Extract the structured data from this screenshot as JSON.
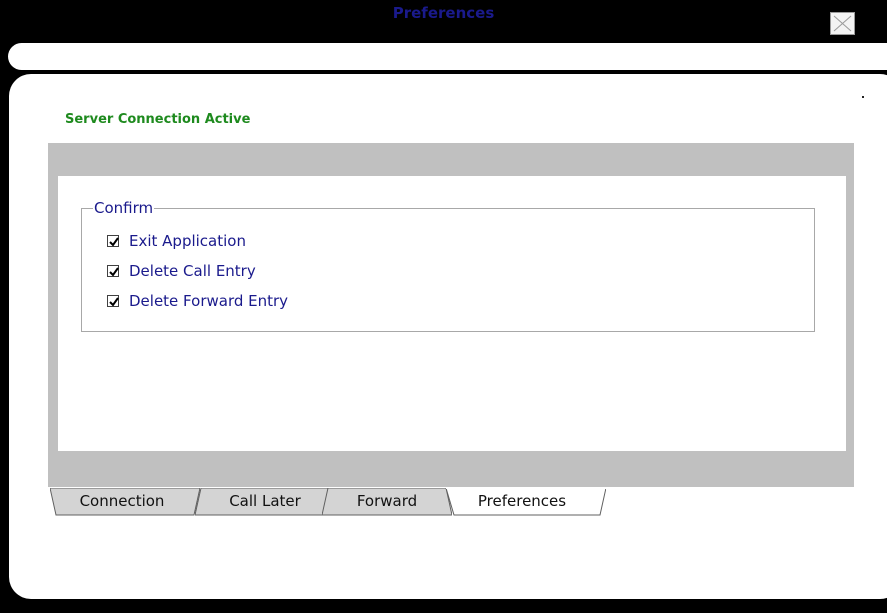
{
  "window": {
    "title": "Preferences",
    "close_icon": "close-icon"
  },
  "status": {
    "text": "Server Connection Active",
    "color": "#1e8a1e"
  },
  "confirm": {
    "legend": "Confirm",
    "items": [
      {
        "label": "Exit Application",
        "checked": true
      },
      {
        "label": "Delete Call Entry",
        "checked": true
      },
      {
        "label": "Delete Forward Entry",
        "checked": true
      }
    ]
  },
  "tabs": [
    {
      "label": "Connection",
      "active": false
    },
    {
      "label": "Call Later",
      "active": false
    },
    {
      "label": "Forward",
      "active": false
    },
    {
      "label": "Preferences",
      "active": true
    }
  ],
  "colors": {
    "title_text": "#1a1a8c",
    "label_text": "#1a1a8c",
    "tab_frame": "#c0c0c0",
    "background": "#000000"
  }
}
